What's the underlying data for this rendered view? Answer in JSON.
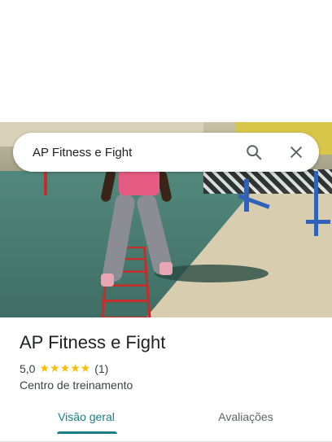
{
  "search": {
    "query": "AP Fitness e Fight"
  },
  "place": {
    "name": "AP Fitness e Fight",
    "rating": "5,0",
    "stars": "★★★★★",
    "review_count": "(1)",
    "category": "Centro de treinamento"
  },
  "tabs": [
    {
      "label": "Visão geral",
      "active": true
    },
    {
      "label": "Avaliações",
      "active": false
    }
  ],
  "colors": {
    "accent": "#1a7f86",
    "star": "#fbbc04"
  },
  "icons": {
    "search": "search-icon",
    "close": "close-icon"
  }
}
